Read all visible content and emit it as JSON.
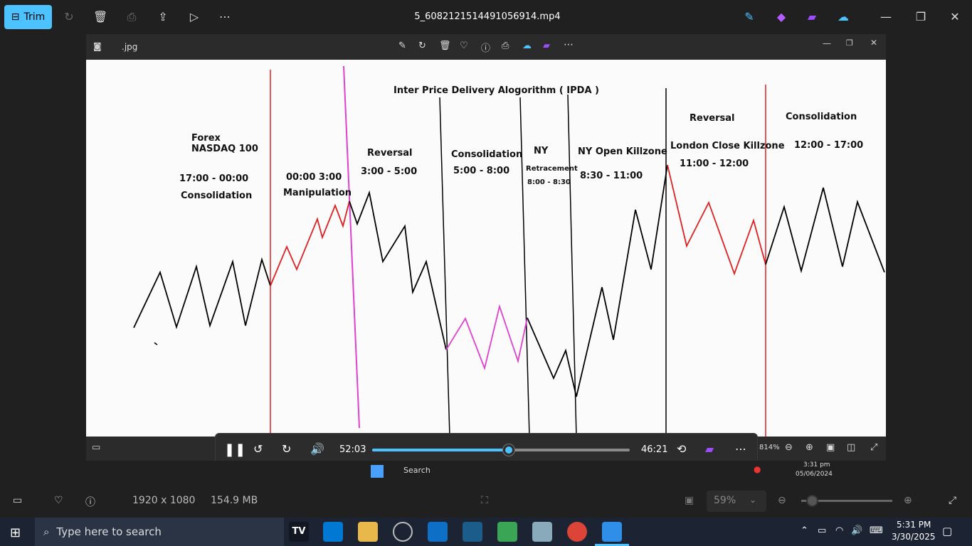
{
  "app": {
    "trim_label": "Trim",
    "title": "5_6082121514491056914.mp4",
    "inner_title": ".jpg"
  },
  "chart": {
    "main_title": "Inter Price Delivery Alogorithm  (  IPDA  )",
    "labels": {
      "forex": "Forex",
      "nasdaq": "NASDAQ 100",
      "time1": "17:00 - 00:00",
      "consol1": "Consolidation",
      "time2": "00:00 3:00",
      "manip": "Manipulation",
      "reversal1": "Reversal",
      "time3": "3:00 - 5:00",
      "consol2": "Consolidation",
      "time4": "5:00 - 8:00",
      "ny": "NY",
      "retracement": "Retracement",
      "time5": "8:00 - 8:30",
      "ny_open": "NY Open Killzone",
      "time6": "8:30 - 11:00",
      "reversal2": "Reversal",
      "london_close": "London Close Killzone",
      "time7": "11:00 - 12:00",
      "consol3": "Consolidation",
      "time8": "12:00  - 17:00"
    }
  },
  "player": {
    "elapsed": "52:03",
    "remaining": "46:21",
    "progress_fraction": 0.53,
    "zoom_readout": "814%"
  },
  "video_taskbar": {
    "search_label": "Search",
    "time": "3:31 pm",
    "date": "05/06/2024"
  },
  "photo_bar": {
    "resolution": "1920 x 1080",
    "size": "154.9 MB",
    "zoom": "59%"
  },
  "taskbar": {
    "search_placeholder": "Type here to search",
    "time": "5:31 PM",
    "date": "3/30/2025"
  }
}
